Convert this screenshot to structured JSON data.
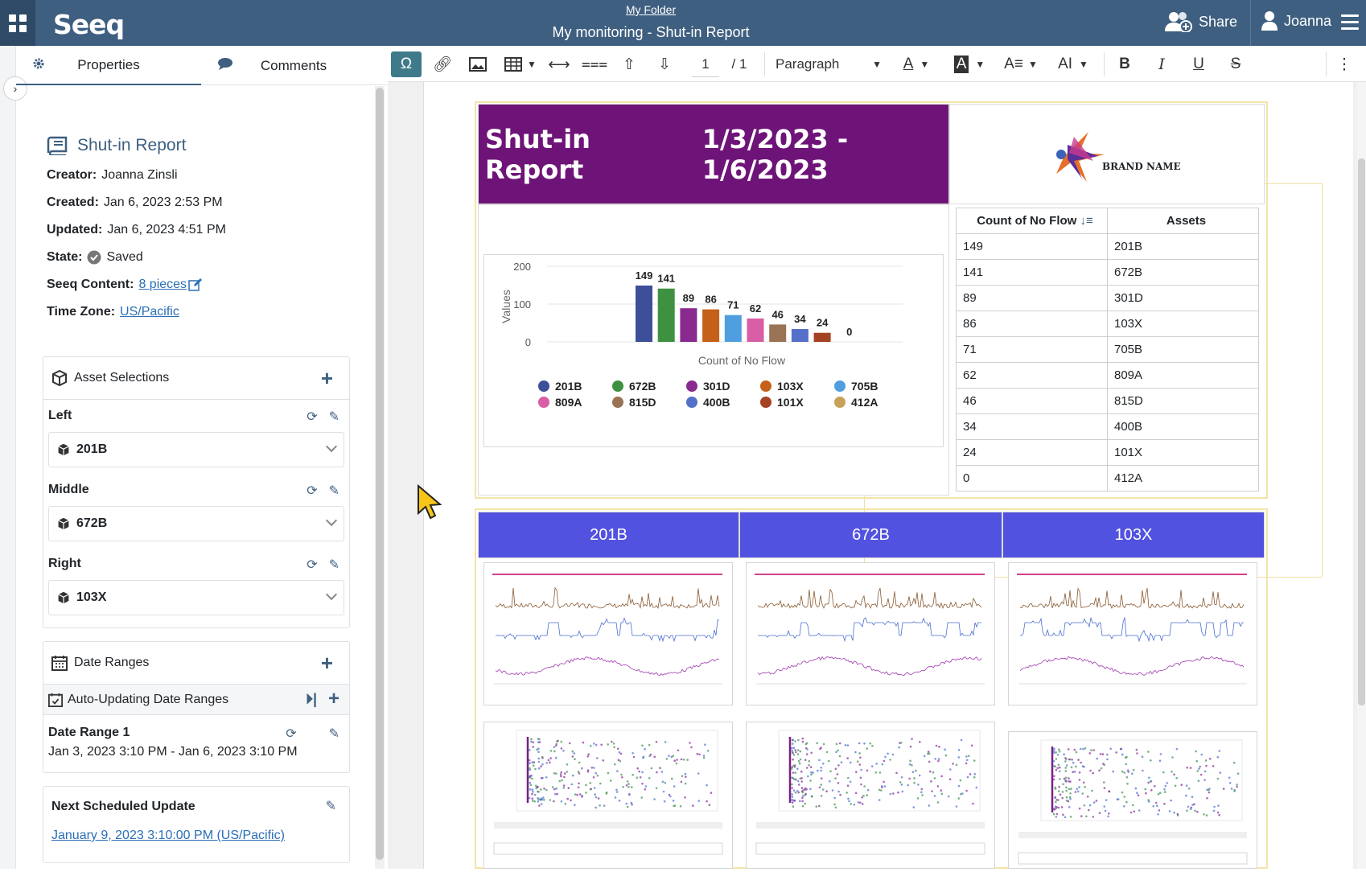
{
  "topbar": {
    "logo": "Seeq",
    "folder_link": "My Folder",
    "title": "My monitoring - Shut-in Report",
    "share_label": "Share",
    "user_name": "Joanna"
  },
  "sidebar": {
    "tabs": [
      {
        "label": "Properties"
      },
      {
        "label": "Comments"
      }
    ],
    "report_title": "Shut-in Report",
    "meta": {
      "creator_label": "Creator:",
      "creator": "Joanna Zinsli",
      "created_label": "Created:",
      "created": "Jan 6, 2023 2:53 PM",
      "updated_label": "Updated:",
      "updated": "Jan 6, 2023 4:51 PM",
      "state_label": "State:",
      "state": "Saved",
      "content_label": "Seeq Content:",
      "content": "8 pieces",
      "tz_label": "Time Zone:",
      "tz": "US/Pacific"
    },
    "asset_panel": {
      "title": "Asset Selections",
      "slots": [
        {
          "label": "Left",
          "value": "201B"
        },
        {
          "label": "Middle",
          "value": "672B"
        },
        {
          "label": "Right",
          "value": "103X"
        }
      ]
    },
    "date_panel": {
      "title": "Date Ranges",
      "auto_label": "Auto-Updating Date Ranges",
      "range_label": "Date Range 1",
      "range_value": "Jan 3, 2023 3:10 PM - Jan 6, 2023 3:10 PM"
    },
    "schedule_panel": {
      "title": "Next Scheduled Update",
      "value": "January 9, 2023 3:10:00 PM (US/Pacific)"
    }
  },
  "toolbar": {
    "page_current": "1",
    "page_total": "/ 1",
    "paragraph": "Paragraph"
  },
  "report": {
    "title": "Shut-in Report",
    "date_range": "1/3/2023 - 1/6/2023",
    "brand": "BRAND NAME",
    "table_headers": [
      "Count of No Flow",
      "Assets"
    ],
    "table_rows": [
      [
        "149",
        "201B"
      ],
      [
        "141",
        "672B"
      ],
      [
        "89",
        "301D"
      ],
      [
        "86",
        "103X"
      ],
      [
        "71",
        "705B"
      ],
      [
        "62",
        "809A"
      ],
      [
        "46",
        "815D"
      ],
      [
        "34",
        "400B"
      ],
      [
        "24",
        "101X"
      ],
      [
        "0",
        "412A"
      ]
    ],
    "asset_columns": [
      "201B",
      "672B",
      "103X"
    ]
  },
  "chart_data": {
    "type": "bar",
    "title": "",
    "xlabel": "Count of No Flow",
    "ylabel": "Values",
    "ylim": [
      0,
      200
    ],
    "yticks": [
      0,
      100,
      200
    ],
    "categories": [
      "201B",
      "672B",
      "301D",
      "103X",
      "705B",
      "809A",
      "815D",
      "400B",
      "101X",
      "412A"
    ],
    "values": [
      149,
      141,
      89,
      86,
      71,
      62,
      46,
      34,
      24,
      0
    ],
    "colors": [
      "#3c4f98",
      "#3f9142",
      "#8a2990",
      "#c4601a",
      "#4f9fe0",
      "#d85ea5",
      "#9a7355",
      "#5570c8",
      "#a44223",
      "#c8a25a"
    ],
    "legend_position": "bottom",
    "grid": true
  }
}
